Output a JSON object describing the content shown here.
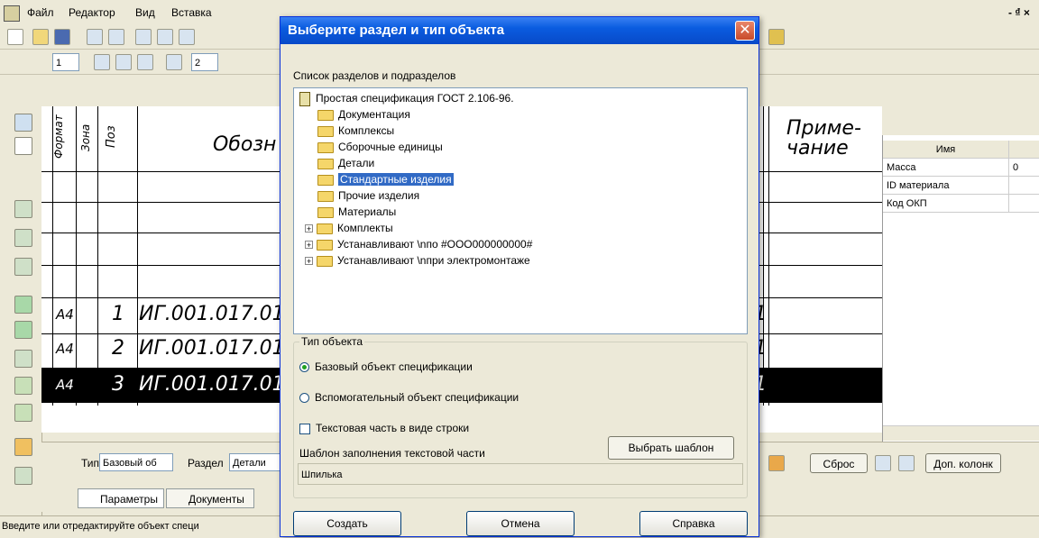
{
  "menu": {
    "items": [
      "Файл",
      "Редактор",
      "Вид",
      "Вставка"
    ],
    "win_controls": "- ₫ ×"
  },
  "toolbar": {
    "page_field": "1",
    "zoom_field": "2"
  },
  "sheet": {
    "headers": {
      "format": "Формат",
      "zone": "Зона",
      "pos": "Поз",
      "designation": "Обозн",
      "note": "Приме-\nчание"
    },
    "rows": [
      {
        "format": "А4",
        "pos": "1",
        "designation": "ИГ.001.017.01",
        "qty": "1"
      },
      {
        "format": "А4",
        "pos": "2",
        "designation": "ИГ.001.017.01",
        "qty": "1"
      },
      {
        "format": "А4",
        "pos": "3",
        "designation": "ИГ.001.017.01",
        "qty": "1"
      }
    ]
  },
  "properties": {
    "header": "Имя",
    "rows": [
      {
        "name": "Масса",
        "value": "0"
      },
      {
        "name": "ID материала",
        "value": ""
      },
      {
        "name": "Код ОКП",
        "value": ""
      }
    ]
  },
  "bottom": {
    "type_label": "Тип",
    "type_value": "Базовый об",
    "section_label": "Раздел",
    "section_value": "Детали",
    "reset_label": "Сброс",
    "extra_columns_label": "Доп. колонк",
    "tabs": [
      "Параметры",
      "Документы"
    ]
  },
  "status": {
    "text": "Введите или отредактируйте объект специ"
  },
  "dialog": {
    "title": "Выберите раздел и тип объекта",
    "list_caption": "Список разделов и подразделов",
    "root": "Простая спецификация ГОСТ 2.106-96.",
    "sections": [
      "Документация",
      "Комплексы",
      "Сборочные единицы",
      "Детали",
      "Стандартные изделия",
      "Прочие изделия",
      "Материалы",
      "Комплекты",
      "Устанавливают \\nпо #ООО000000000#",
      "Устанавливают \\nпри электромонтаже"
    ],
    "selected_index": 4,
    "object_type_caption": "Тип объекта",
    "radio_base": "Базовый объект спецификации",
    "radio_aux": "Вспомогательный объект спецификации",
    "checkbox_text_line": "Текстовая часть в виде строки",
    "template_label": "Шаблон заполнения текстовой части",
    "choose_template": "Выбрать шаблон",
    "template_value": "Шпилька",
    "btn_create": "Создать",
    "btn_cancel": "Отмена",
    "btn_help": "Справка"
  }
}
